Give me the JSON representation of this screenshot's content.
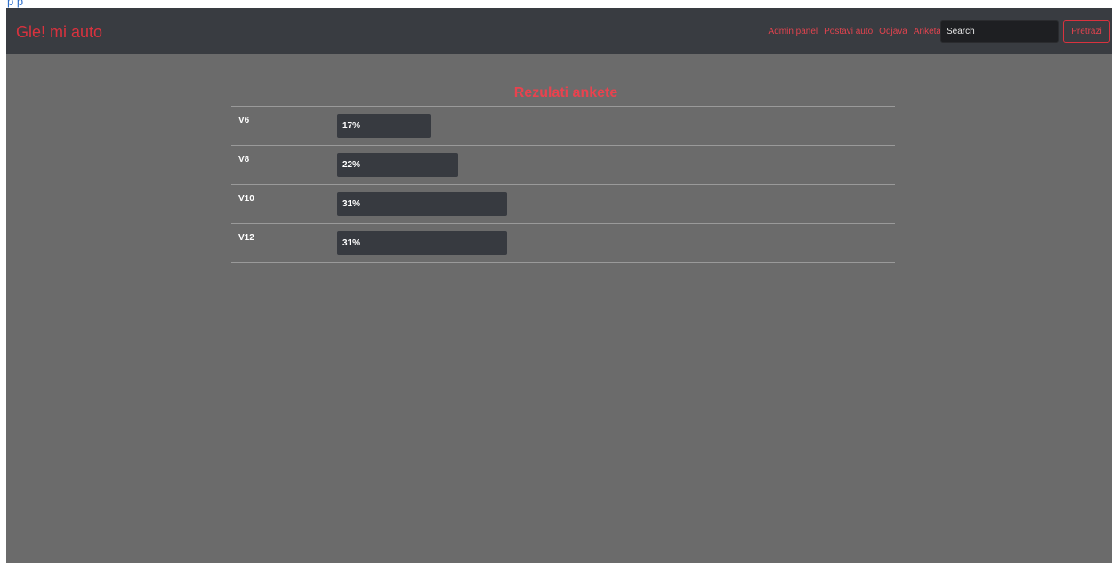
{
  "nav": {
    "brand": "Gle! mi auto",
    "links": [
      "Admin panel",
      "Postavi auto",
      "Odjava",
      "Anketa"
    ],
    "search": {
      "placeholder": "Search",
      "button": "Pretrazi"
    }
  },
  "results": {
    "title": "Rezulati ankete",
    "rows": [
      {
        "label": "V6",
        "percent": 17,
        "text": "17%"
      },
      {
        "label": "V8",
        "percent": 22,
        "text": "22%"
      },
      {
        "label": "V10",
        "percent": 31,
        "text": "31%"
      },
      {
        "label": "V12",
        "percent": 31,
        "text": "31%"
      }
    ]
  },
  "colors": {
    "accent": "#d9323e",
    "navbar": "#393c41",
    "page": "#6b6b6b",
    "bar": "#373a40"
  }
}
